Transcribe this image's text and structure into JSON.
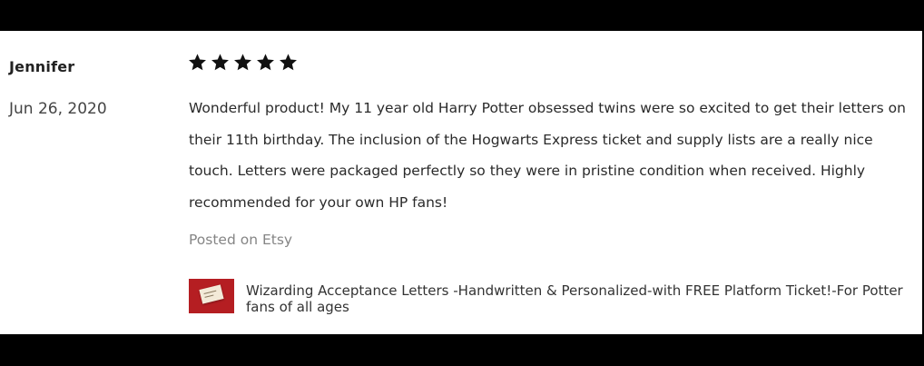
{
  "review": {
    "reviewer_name": "Jennifer",
    "date": "Jun 26, 2020",
    "rating": 5,
    "max_rating": 5,
    "text": "Wonderful product! My 11 year old Harry Potter obsessed twins were so excited to get their letters on their 11th birthday. The inclusion of the Hogwarts Express ticket and supply lists are a really nice touch. Letters were packaged perfectly so they were in pristine condition when received. Highly recommended for your own HP fans!",
    "source": "Posted on Etsy"
  },
  "product": {
    "title": "Wizarding Acceptance Letters -Handwritten & Personalized-with FREE Platform Ticket!-For Potter fans of all ages",
    "thumbnail_icon": "product-thumbnail-image"
  },
  "colors": {
    "background": "#ffffff",
    "frame": "#000000",
    "star": "#111111",
    "muted_text": "#858585",
    "thumbnail_red": "#b51e22"
  }
}
